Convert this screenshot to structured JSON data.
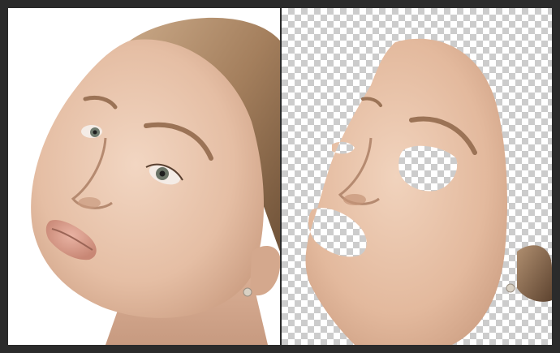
{
  "canvas": {
    "background_color": "#2b2b2b",
    "transparency_checker_colors": [
      "#ffffff",
      "#cccccc"
    ]
  },
  "panels": [
    {
      "label": "",
      "content": "portrait-photo-original",
      "skin_color": "#e9c6ae",
      "hair_color": "#a98462"
    },
    {
      "label": "",
      "content": "extracted-skin-layer-on-transparent",
      "skin_color": "#e8c0a6",
      "hair_color": "#8a6a4c"
    }
  ]
}
